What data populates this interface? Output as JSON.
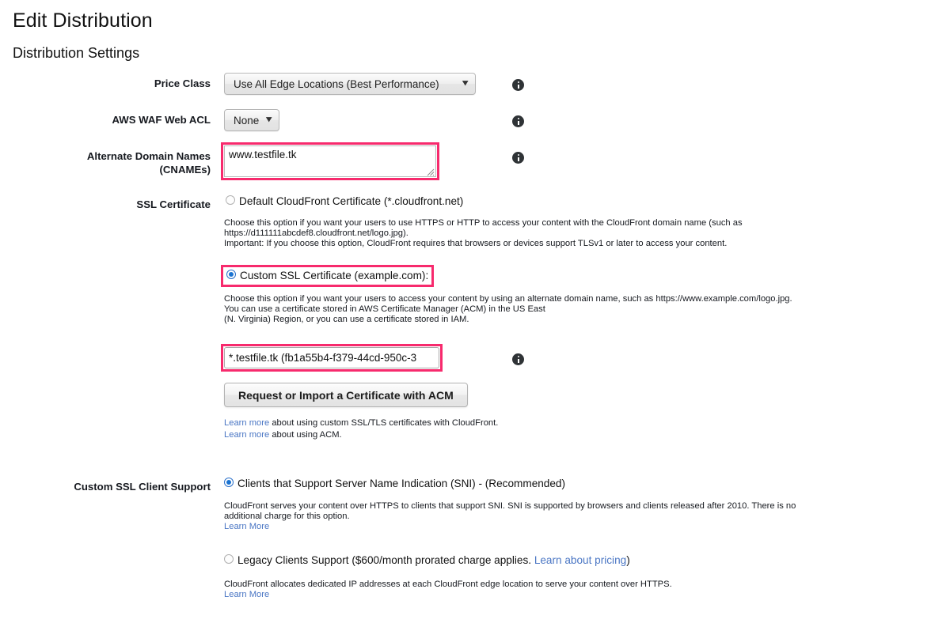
{
  "page": {
    "title": "Edit Distribution",
    "section_title": "Distribution Settings"
  },
  "colors": {
    "highlight_pink": "#f72a6d",
    "link_blue": "#4a76c4",
    "radio_blue": "#1a73d1",
    "info_icon": "#2f3336"
  },
  "fields": {
    "price_class": {
      "label": "Price Class",
      "value": "Use All Edge Locations (Best Performance)",
      "chevron": "∨",
      "info": "info-icon"
    },
    "waf": {
      "label": "AWS WAF Web ACL",
      "value": "None",
      "chevron": "∨",
      "info": "info-icon"
    },
    "cnames": {
      "label_line1": "Alternate Domain Names",
      "label_line2": "(CNAMEs)",
      "value": "www.testfile.tk",
      "placeholder": "",
      "info": "info-icon",
      "highlighted": true
    },
    "ssl_certificate": {
      "label": "SSL Certificate",
      "options": [
        {
          "id": "default-cert",
          "label": "Default CloudFront Certificate (*.cloudfront.net)",
          "selected": false,
          "highlighted": false,
          "desc_lines": [
            "Choose this option if you want your users to use HTTPS or HTTP to access your content with the CloudFront domain name (such as",
            "https://d111111abcdef8.cloudfront.net/logo.jpg).",
            "Important: If you choose this option, CloudFront requires that browsers or devices support TLSv1 or later to access your content."
          ]
        },
        {
          "id": "custom-cert",
          "label": "Custom SSL Certificate (example.com):",
          "selected": true,
          "highlighted": true,
          "desc_lines": [
            "Choose this option if you want your users to access your content by using an alternate domain name, such as https://www.example.com/logo.jpg.",
            "You can use a certificate stored in AWS Certificate Manager (ACM) in the US East",
            "(N. Virginia) Region, or you can use a certificate stored in IAM."
          ]
        }
      ],
      "cert_select_value": "*.testfile.tk (fb1a55b4-f379-44cd-950c-3",
      "cert_select_highlighted": true,
      "cert_select_info": "info-icon",
      "acm_button": "Request or Import a Certificate with ACM",
      "learn_links": [
        {
          "link": "Learn more",
          "rest": " about using custom SSL/TLS certificates with CloudFront."
        },
        {
          "link": "Learn more",
          "rest": " about using ACM."
        }
      ]
    },
    "client_support": {
      "label": "Custom SSL Client Support",
      "options": [
        {
          "id": "sni",
          "label": "Clients that Support Server Name Indication (SNI) - (Recommended)",
          "selected": true,
          "desc_lines": [
            "CloudFront serves your content over HTTPS to clients that support SNI. SNI is supported by browsers and clients released after 2010. There is no",
            "additional charge for this option."
          ],
          "learn_more": "Learn More"
        },
        {
          "id": "legacy",
          "label_pre": "Legacy Clients Support ($600/month prorated charge applies. ",
          "label_link": "Learn about pricing",
          "label_post": ")",
          "selected": false,
          "desc_lines": [
            "CloudFront allocates dedicated IP addresses at each CloudFront edge location to serve your content over HTTPS."
          ],
          "learn_more": "Learn More"
        }
      ]
    }
  }
}
